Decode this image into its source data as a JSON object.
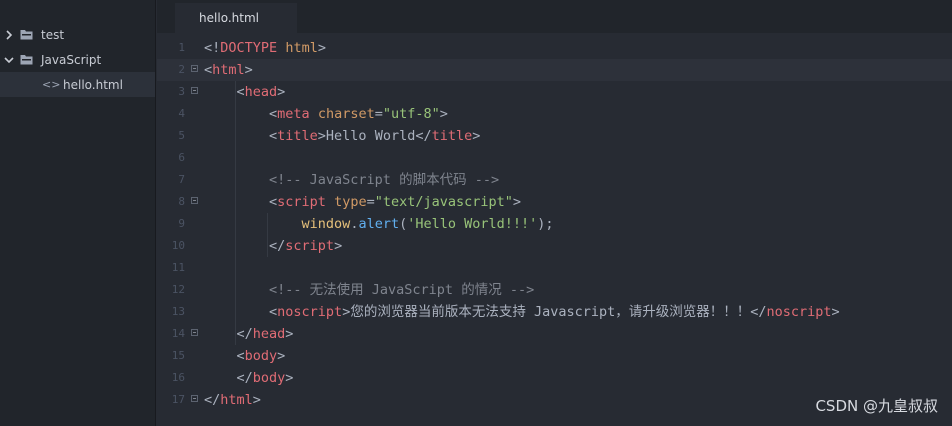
{
  "sidebar": {
    "items": [
      {
        "label": "test",
        "icon": "folder-icon",
        "expanded": false
      },
      {
        "label": "JavaScript",
        "icon": "folder-icon",
        "expanded": true
      },
      {
        "label": "hello.html",
        "icon": "code-file-icon",
        "prefix": "<>",
        "selected": true
      }
    ]
  },
  "tabs": [
    {
      "label": "hello.html",
      "active": true
    }
  ],
  "editor": {
    "line_numbers": [
      "1",
      "2",
      "3",
      "4",
      "5",
      "6",
      "7",
      "8",
      "9",
      "10",
      "11",
      "12",
      "13",
      "14",
      "15",
      "16",
      "17"
    ],
    "lines": [
      [
        [
          "t-br",
          "<!"
        ],
        [
          "t-doc",
          "DOCTYPE"
        ],
        [
          "t-br",
          " "
        ],
        [
          "t-attr",
          "html"
        ],
        [
          "t-br",
          ">"
        ]
      ],
      [
        [
          "t-br",
          "<"
        ],
        [
          "t-tag",
          "html"
        ],
        [
          "t-br",
          ">"
        ]
      ],
      [
        [
          "t-br",
          "    <"
        ],
        [
          "t-tag",
          "head"
        ],
        [
          "t-br",
          ">"
        ]
      ],
      [
        [
          "t-br",
          "        <"
        ],
        [
          "t-tag",
          "meta"
        ],
        [
          "t-br",
          " "
        ],
        [
          "t-attr",
          "charset"
        ],
        [
          "t-br",
          "="
        ],
        [
          "t-str",
          "\"utf-8\""
        ],
        [
          "t-br",
          ">"
        ]
      ],
      [
        [
          "t-br",
          "        <"
        ],
        [
          "t-tag",
          "title"
        ],
        [
          "t-br",
          ">Hello World</"
        ],
        [
          "t-tag",
          "title"
        ],
        [
          "t-br",
          ">"
        ]
      ],
      [],
      [
        [
          "t-cmt",
          "        <!-- JavaScript 的脚本代码 -->"
        ]
      ],
      [
        [
          "t-br",
          "        <"
        ],
        [
          "t-tag",
          "script"
        ],
        [
          "t-br",
          " "
        ],
        [
          "t-attr",
          "type"
        ],
        [
          "t-br",
          "="
        ],
        [
          "t-str",
          "\"text/javascript\""
        ],
        [
          "t-br",
          ">"
        ]
      ],
      [
        [
          "t-br",
          "            "
        ],
        [
          "t-obj",
          "window"
        ],
        [
          "t-br",
          "."
        ],
        [
          "t-fn",
          "alert"
        ],
        [
          "t-br",
          "("
        ],
        [
          "t-str",
          "'Hello World!!!'"
        ],
        [
          "t-br",
          ");"
        ]
      ],
      [
        [
          "t-br",
          "        </"
        ],
        [
          "t-tag",
          "script"
        ],
        [
          "t-br",
          ">"
        ]
      ],
      [],
      [
        [
          "t-cmt",
          "        <!-- 无法使用 JavaScript 的情况 -->"
        ]
      ],
      [
        [
          "t-br",
          "        <"
        ],
        [
          "t-tag",
          "noscript"
        ],
        [
          "t-br",
          ">您的浏览器当前版本无法支持 Javascript，请升级浏览器！！！</"
        ],
        [
          "t-tag",
          "noscript"
        ],
        [
          "t-br",
          ">"
        ]
      ],
      [
        [
          "t-br",
          "    </"
        ],
        [
          "t-tag",
          "head"
        ],
        [
          "t-br",
          ">"
        ]
      ],
      [
        [
          "t-br",
          "    <"
        ],
        [
          "t-tag",
          "body"
        ],
        [
          "t-br",
          ">"
        ]
      ],
      [
        [
          "t-br",
          "    </"
        ],
        [
          "t-tag",
          "body"
        ],
        [
          "t-br",
          ">"
        ]
      ],
      [
        [
          "t-br",
          "</"
        ],
        [
          "t-tag",
          "html"
        ],
        [
          "t-br",
          ">"
        ]
      ]
    ],
    "fold_markers": [
      "2",
      "3",
      "8",
      "14",
      "17"
    ],
    "active_line": "2"
  },
  "watermark": "CSDN @九皇叔叔"
}
